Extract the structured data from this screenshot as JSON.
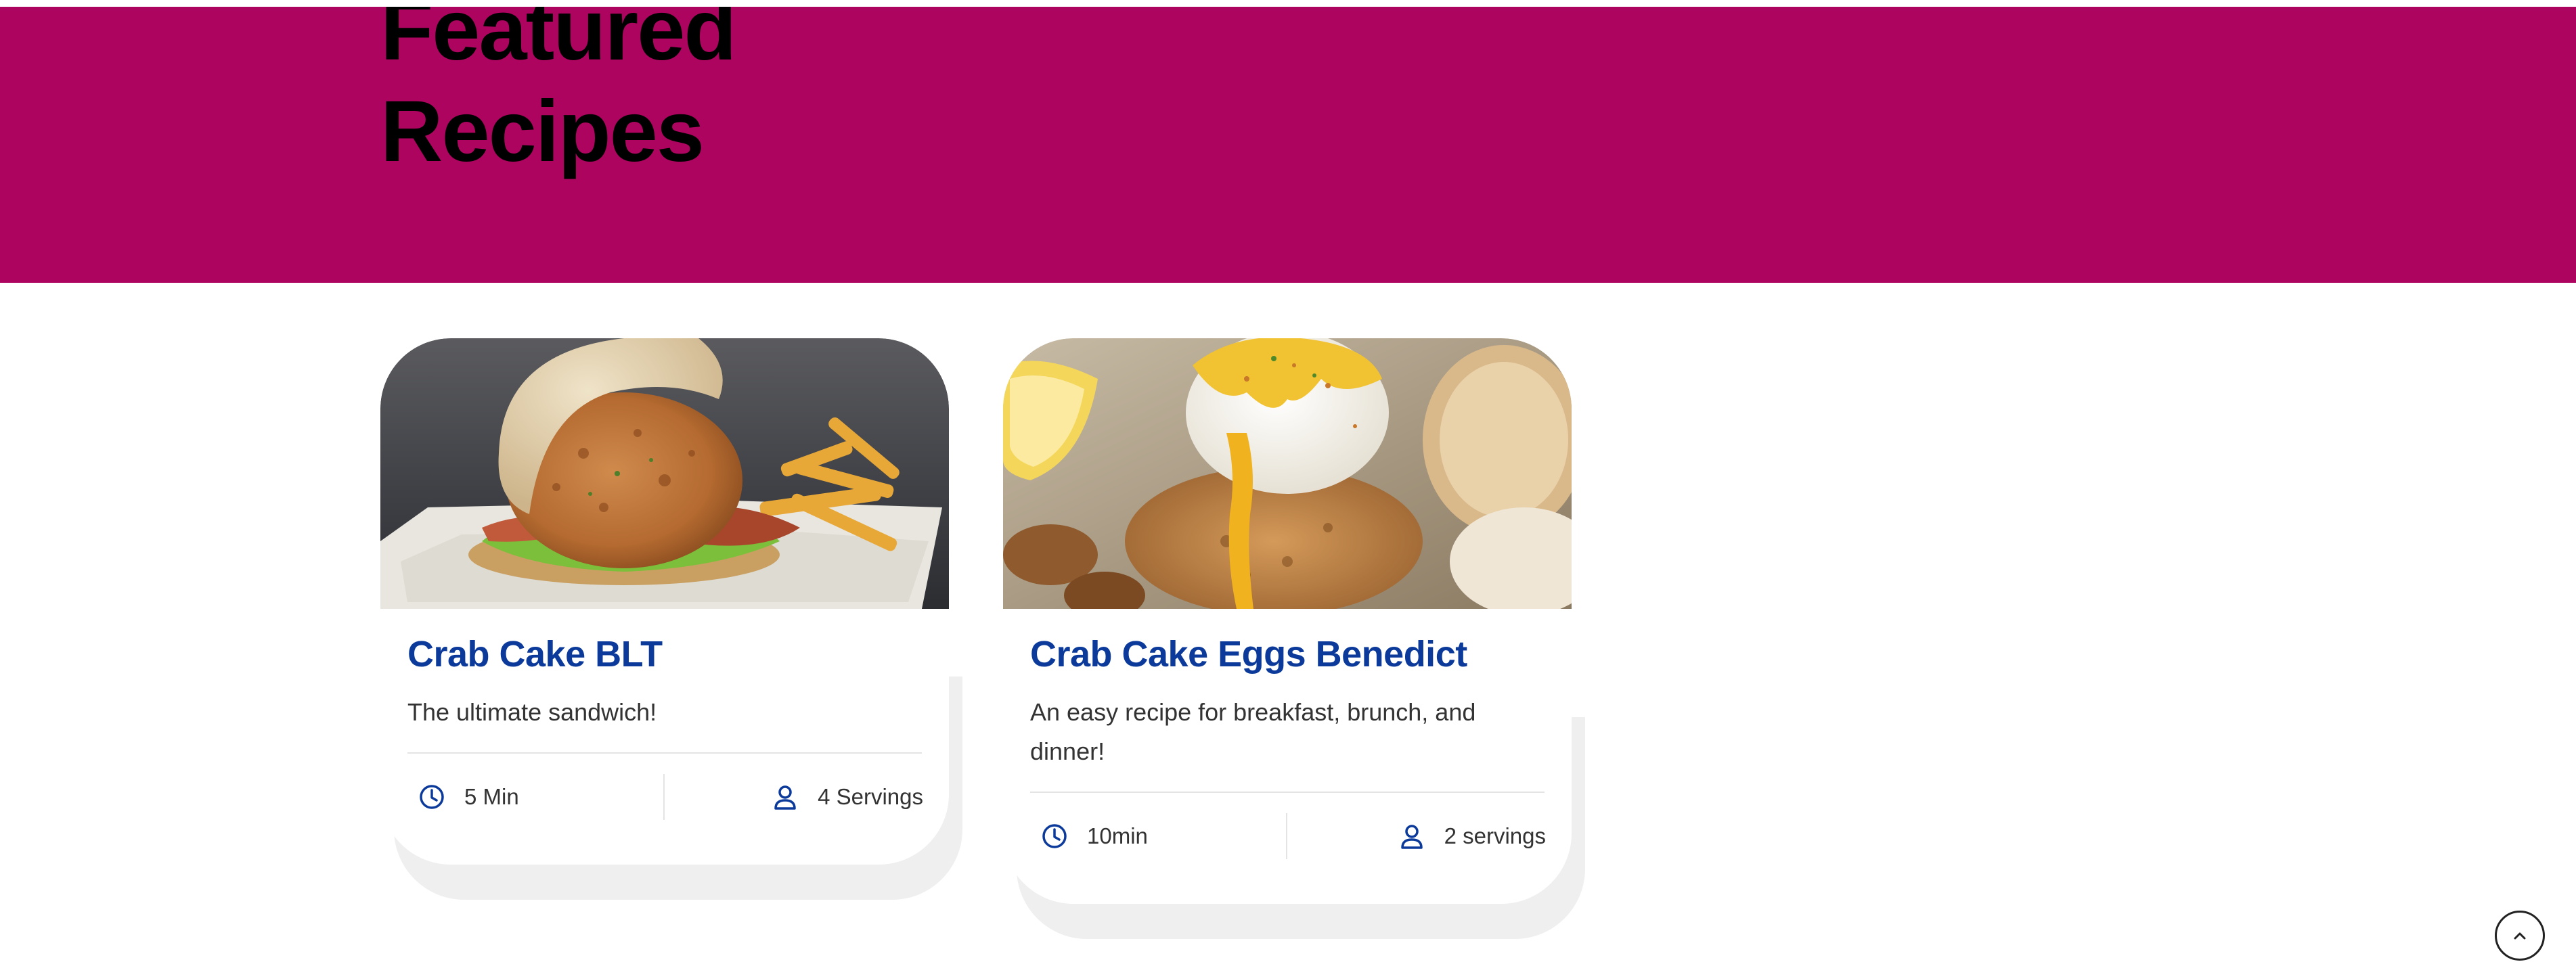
{
  "hero": {
    "background_color": "#ad045f",
    "title_line_1": "Featured",
    "title_line_2": "Recipes"
  },
  "accent_color": "#0b3a9a",
  "recipes": [
    {
      "title": "Crab Cake BLT",
      "description": "The ultimate sandwich!",
      "time": "5 Min",
      "servings": "4 Servings",
      "image": "crab-cake-blt-photo",
      "time_icon": "clock-icon",
      "servings_icon": "person-icon"
    },
    {
      "title": "Crab Cake Eggs Benedict",
      "description": "An easy recipe for breakfast, brunch, and dinner!",
      "time": "10min",
      "servings": "2 servings",
      "image": "crab-cake-eggs-benedict-photo",
      "time_icon": "clock-icon",
      "servings_icon": "person-icon"
    }
  ],
  "back_to_top": {
    "icon": "chevron-up-icon"
  }
}
